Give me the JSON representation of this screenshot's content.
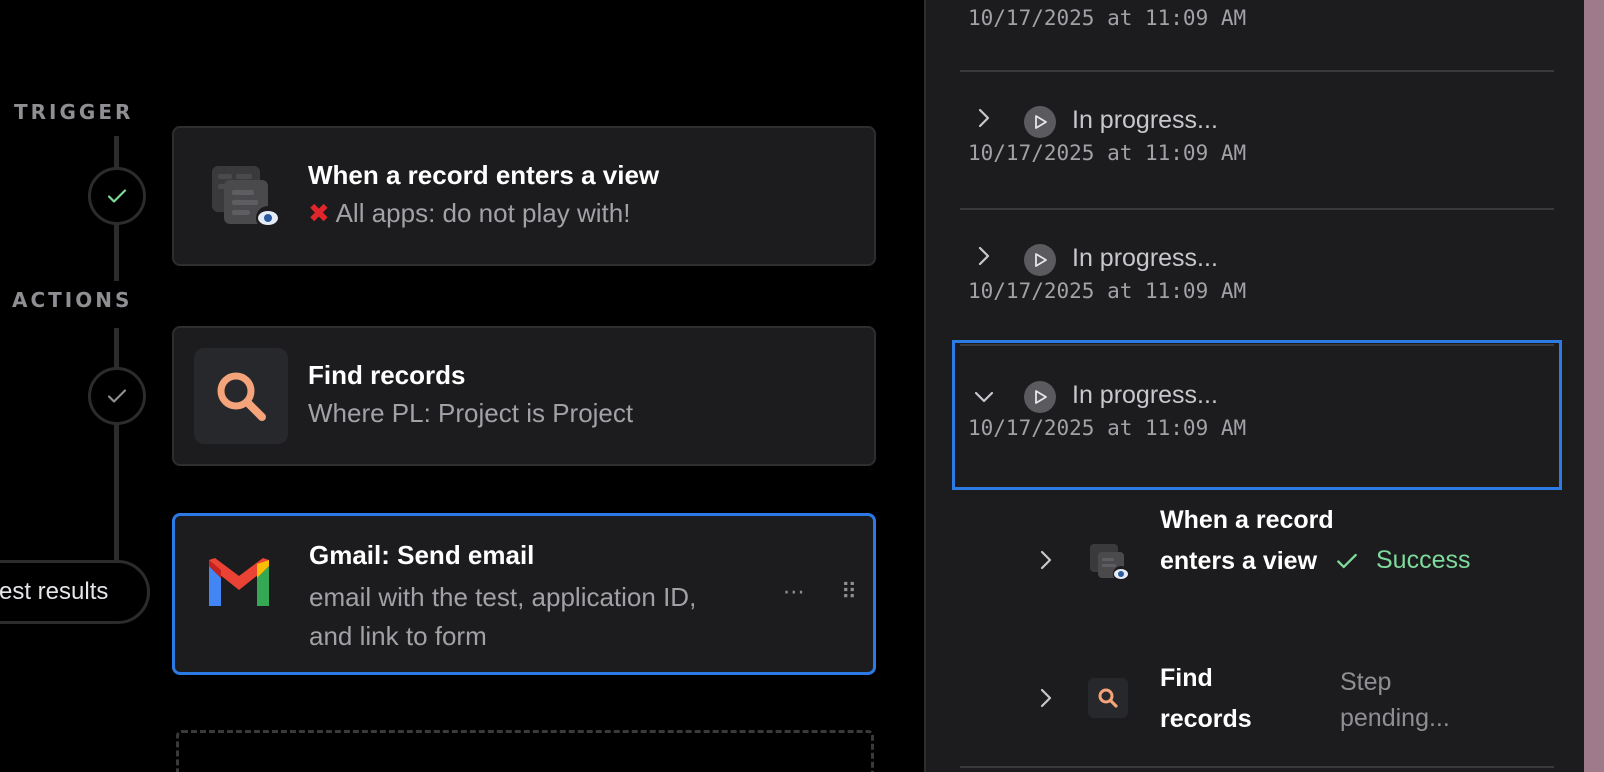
{
  "canvas": {
    "trigger_label": "TRIGGER",
    "actions_label": "ACTIONS",
    "test_results_label": "est results",
    "cards": [
      {
        "title": "When a record enters a view",
        "subtitle_icon": "red-x-icon",
        "subtitle": "All apps: do not play with!",
        "icon": "record-view-icon"
      },
      {
        "title": "Find records",
        "subtitle": "Where PL: Project is Project",
        "icon": "search-icon"
      },
      {
        "title": "Gmail: Send email",
        "subtitle": "email with the test, application ID, and link to form",
        "icon": "gmail-icon",
        "more_icon": "ellipsis-icon",
        "drag_icon": "drag-handle-icon"
      }
    ]
  },
  "panel": {
    "runs": [
      {
        "status": "",
        "date": "10/17/2025 at 11:09 AM"
      },
      {
        "status": "In progress...",
        "date": "10/17/2025 at 11:09 AM"
      },
      {
        "status": "In progress...",
        "date": "10/17/2025 at 11:09 AM"
      },
      {
        "status": "In progress...",
        "date": "10/17/2025 at 11:09 AM",
        "expanded": true
      }
    ],
    "steps": [
      {
        "name": "When a record enters a view",
        "status": "Success",
        "status_icon": "check-icon"
      },
      {
        "name": "Find records",
        "status": "Step pending..."
      }
    ]
  },
  "colors": {
    "accent": "#2c7be5",
    "success": "#7ed99a",
    "search_orange": "#f5a37a",
    "error_red": "#e0262b"
  }
}
